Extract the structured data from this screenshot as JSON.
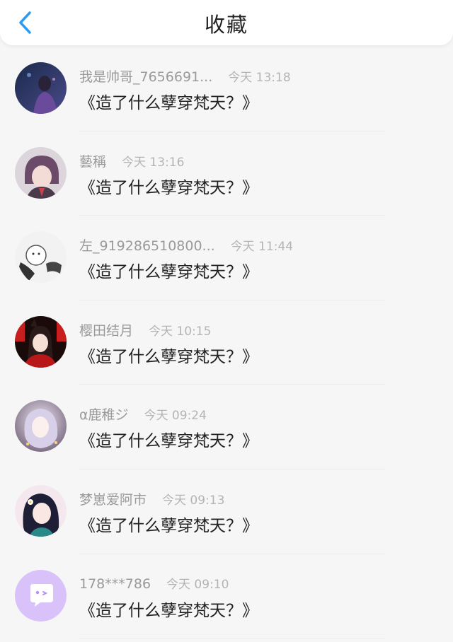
{
  "header": {
    "title": "收藏",
    "accent_color": "#2f9bf0"
  },
  "favorites": [
    {
      "name": "我是帅哥_7656691...",
      "time": "今天 13:18",
      "book": "《造了什么孽穿梵天？》"
    },
    {
      "name": "藝稱",
      "time": "今天 13:16",
      "book": "《造了什么孽穿梵天？》"
    },
    {
      "name": "左_919286510800...",
      "time": "今天 11:44",
      "book": "《造了什么孽穿梵天？》"
    },
    {
      "name": "樱田结月",
      "time": "今天 10:15",
      "book": "《造了什么孽穿梵天？》"
    },
    {
      "name": "α鹿稚ジ",
      "time": "今天 09:24",
      "book": "《造了什么孽穿梵天？》"
    },
    {
      "name": "梦崽爱阿市",
      "time": "今天 09:13",
      "book": "《造了什么孽穿梵天？》"
    },
    {
      "name": "178***786",
      "time": "今天 09:10",
      "book": "《造了什么孽穿梵天？》"
    }
  ]
}
